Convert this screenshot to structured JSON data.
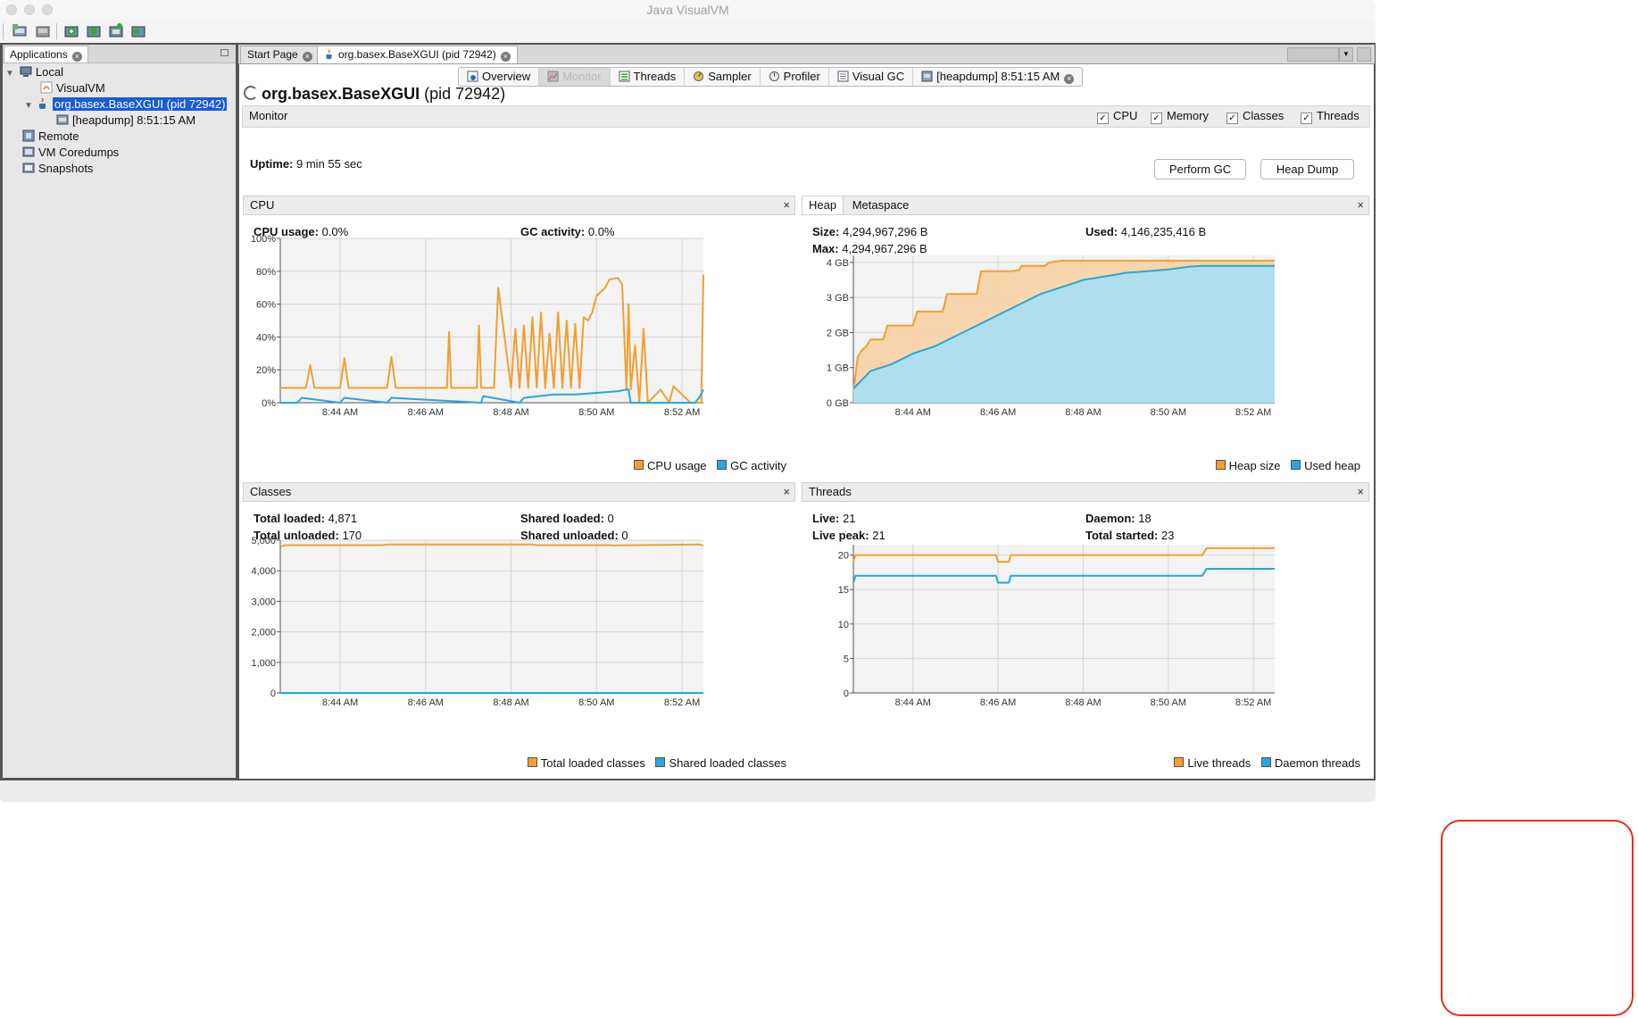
{
  "window": {
    "title": "Java VisualVM"
  },
  "toolbar": {
    "icons": [
      "add-jmx-connection-icon",
      "add-snapshot-icon",
      "add-application-icon",
      "heap-dump-icon",
      "thread-dump-icon",
      "profiler-snapshot-icon"
    ]
  },
  "sidebar": {
    "tab_label": "Applications",
    "nodes": {
      "local": "Local",
      "visualvm": "VisualVM",
      "app": "org.basex.BaseXGUI (pid 72942)",
      "heapdump": "[heapdump] 8:51:15 AM",
      "remote": "Remote",
      "coredumps": "VM Coredumps",
      "snapshots": "Snapshots"
    }
  },
  "doc_tabs": {
    "start": "Start Page",
    "app": "org.basex.BaseXGUI (pid 72942)"
  },
  "subtabs": {
    "overview": "Overview",
    "monitor": "Monitor",
    "threads": "Threads",
    "sampler": "Sampler",
    "profiler": "Profiler",
    "visualgc": "Visual GC",
    "heapdump": "[heapdump] 8:51:15 AM"
  },
  "header": {
    "app_name": "org.basex.BaseXGUI",
    "pid": "(pid 72942)"
  },
  "monitor": {
    "label": "Monitor",
    "checks": {
      "cpu": "CPU",
      "memory": "Memory",
      "classes": "Classes",
      "threads": "Threads"
    },
    "uptime_label": "Uptime:",
    "uptime_value": "9 min 55 sec",
    "perform_gc": "Perform GC",
    "heap_dump": "Heap Dump"
  },
  "cpu_panel": {
    "title": "CPU",
    "usage_label": "CPU usage:",
    "usage_value": "0.0%",
    "gc_label": "GC activity:",
    "gc_value": "0.0%",
    "legend": {
      "cpu": "CPU usage",
      "gc": "GC activity"
    }
  },
  "heap_panel": {
    "tab_heap": "Heap",
    "tab_meta": "Metaspace",
    "size_label": "Size:",
    "size_value": "4,294,967,296 B",
    "used_label": "Used:",
    "used_value": "4,146,235,416 B",
    "max_label": "Max:",
    "max_value": "4,294,967,296 B",
    "legend": {
      "size": "Heap size",
      "used": "Used heap"
    }
  },
  "classes_panel": {
    "title": "Classes",
    "total_loaded_label": "Total loaded:",
    "total_loaded_value": "4,871",
    "total_unloaded_label": "Total unloaded:",
    "total_unloaded_value": "170",
    "shared_loaded_label": "Shared loaded:",
    "shared_loaded_value": "0",
    "shared_unloaded_label": "Shared unloaded:",
    "shared_unloaded_value": "0",
    "legend": {
      "total": "Total loaded classes",
      "shared": "Shared loaded classes"
    }
  },
  "threads_panel": {
    "title": "Threads",
    "live_label": "Live:",
    "live_value": "21",
    "daemon_label": "Daemon:",
    "daemon_value": "18",
    "peak_label": "Live peak:",
    "peak_value": "21",
    "started_label": "Total started:",
    "started_value": "23",
    "legend": {
      "live": "Live threads",
      "daemon": "Daemon threads"
    }
  },
  "colors": {
    "orange": "#f0a030",
    "blue": "#2aa6d8",
    "grid": "#d4d4d4",
    "selection": "#1a5bd6"
  },
  "chart_data": [
    {
      "type": "line",
      "name": "CPU",
      "x_ticks": [
        "8:44 AM",
        "8:46 AM",
        "8:48 AM",
        "8:50 AM",
        "8:52 AM"
      ],
      "y_ticks": [
        "0%",
        "20%",
        "40%",
        "60%",
        "80%",
        "100%"
      ],
      "ylim": [
        0,
        100
      ],
      "xlim_minutes": [
        42.6,
        52.5
      ],
      "series": [
        {
          "name": "CPU usage",
          "color": "#f0a030",
          "x": [
            42.6,
            43.2,
            43.3,
            43.4,
            44.0,
            44.1,
            44.2,
            45.1,
            45.2,
            45.3,
            46.5,
            46.55,
            46.6,
            47.2,
            47.25,
            47.3,
            47.6,
            47.7,
            48.0,
            48.1,
            48.2,
            48.3,
            48.4,
            48.5,
            48.6,
            48.7,
            48.8,
            48.9,
            49.0,
            49.1,
            49.2,
            49.3,
            49.4,
            49.5,
            49.6,
            49.7,
            49.8,
            49.9,
            50.0,
            50.2,
            50.3,
            50.5,
            50.6,
            50.7,
            50.75,
            50.8,
            50.9,
            51.0,
            51.1,
            51.2,
            51.5,
            51.7,
            51.8,
            52.2,
            52.45,
            52.5
          ],
          "y": [
            9,
            9,
            23,
            9,
            9,
            27,
            9,
            9,
            28,
            9,
            9,
            43,
            9,
            9,
            47,
            9,
            9,
            70,
            9,
            45,
            9,
            47,
            9,
            52,
            9,
            55,
            9,
            42,
            9,
            55,
            9,
            50,
            9,
            48,
            9,
            52,
            50,
            55,
            65,
            70,
            75,
            76,
            72,
            8,
            60,
            8,
            35,
            0,
            45,
            0,
            8,
            0,
            10,
            0,
            0,
            78
          ]
        },
        {
          "name": "GC activity",
          "color": "#2aa6d8",
          "x": [
            42.6,
            43.0,
            43.1,
            44.0,
            44.1,
            45.1,
            45.2,
            47.3,
            47.35,
            48.2,
            48.3,
            49.0,
            49.5,
            50.0,
            50.5,
            50.7,
            50.75,
            50.8,
            51.0,
            52.3,
            52.4,
            52.5
          ],
          "y": [
            0,
            0,
            3,
            0,
            3,
            0,
            3,
            0,
            4,
            0,
            3,
            5,
            5,
            6,
            7,
            8,
            8,
            0,
            0,
            0,
            3,
            8
          ]
        }
      ]
    },
    {
      "type": "area",
      "name": "Heap",
      "x_ticks": [
        "8:44 AM",
        "8:46 AM",
        "8:48 AM",
        "8:50 AM",
        "8:52 AM"
      ],
      "y_ticks": [
        "0 GB",
        "1 GB",
        "2 GB",
        "3 GB",
        "4 GB"
      ],
      "ylim": [
        0,
        4.2
      ],
      "xlim_minutes": [
        42.6,
        52.5
      ],
      "series": [
        {
          "name": "Heap size",
          "color": "#f0a030",
          "x": [
            42.6,
            42.7,
            42.8,
            42.9,
            43.0,
            43.3,
            43.4,
            44.0,
            44.1,
            44.7,
            44.8,
            45.5,
            45.6,
            46.3,
            46.5,
            46.55,
            47.1,
            47.2,
            47.5,
            48.5,
            49.5,
            50.5,
            51.5,
            52.5
          ],
          "y": [
            0.3,
            1.3,
            1.5,
            1.6,
            1.8,
            1.8,
            2.2,
            2.2,
            2.6,
            2.6,
            3.1,
            3.1,
            3.75,
            3.75,
            3.78,
            3.9,
            3.9,
            4.0,
            4.05,
            4.05,
            4.05,
            4.05,
            4.05,
            4.05
          ]
        },
        {
          "name": "Used heap",
          "color": "#2aa6d8",
          "x": [
            42.6,
            43.0,
            43.5,
            44.0,
            44.5,
            45.0,
            45.5,
            46.0,
            46.5,
            47.0,
            47.5,
            48.0,
            48.5,
            49.0,
            49.5,
            50.0,
            50.5,
            50.8,
            51.0,
            51.5,
            52.0,
            52.5
          ],
          "y": [
            0.4,
            0.9,
            1.1,
            1.4,
            1.6,
            1.9,
            2.2,
            2.5,
            2.8,
            3.1,
            3.3,
            3.5,
            3.6,
            3.7,
            3.75,
            3.8,
            3.88,
            3.9,
            3.9,
            3.9,
            3.9,
            3.9
          ]
        }
      ]
    },
    {
      "type": "line",
      "name": "Classes",
      "x_ticks": [
        "8:44 AM",
        "8:46 AM",
        "8:48 AM",
        "8:50 AM",
        "8:52 AM"
      ],
      "y_ticks": [
        "0",
        "1,000",
        "2,000",
        "3,000",
        "4,000",
        "5,000"
      ],
      "ylim": [
        0,
        5000
      ],
      "xlim_minutes": [
        42.6,
        52.5
      ],
      "series": [
        {
          "name": "Total loaded classes",
          "color": "#f0a030",
          "x": [
            42.6,
            42.7,
            45.0,
            45.1,
            48.5,
            48.6,
            50.3,
            50.4,
            52.4,
            52.5
          ],
          "y": [
            4780,
            4840,
            4840,
            4860,
            4860,
            4840,
            4840,
            4830,
            4860,
            4830
          ]
        },
        {
          "name": "Shared loaded classes",
          "color": "#2aa6d8",
          "x": [
            42.6,
            52.5
          ],
          "y": [
            0,
            0
          ]
        }
      ]
    },
    {
      "type": "line",
      "name": "Threads",
      "x_ticks": [
        "8:44 AM",
        "8:46 AM",
        "8:48 AM",
        "8:50 AM",
        "8:52 AM"
      ],
      "y_ticks": [
        "0",
        "5",
        "10",
        "15",
        "20"
      ],
      "ylim": [
        0,
        21.5
      ],
      "xlim_minutes": [
        42.6,
        52.5
      ],
      "series": [
        {
          "name": "Live threads",
          "color": "#f0a030",
          "x": [
            42.6,
            42.65,
            45.95,
            46.0,
            46.25,
            46.3,
            50.8,
            50.9,
            52.5
          ],
          "y": [
            19,
            20,
            20,
            19,
            19,
            20,
            20,
            21,
            21
          ]
        },
        {
          "name": "Daemon threads",
          "color": "#2aa6d8",
          "x": [
            42.6,
            42.65,
            45.95,
            46.0,
            46.25,
            46.3,
            50.8,
            50.9,
            52.5
          ],
          "y": [
            16,
            17,
            17,
            16,
            16,
            17,
            17,
            18,
            18
          ]
        }
      ]
    }
  ]
}
